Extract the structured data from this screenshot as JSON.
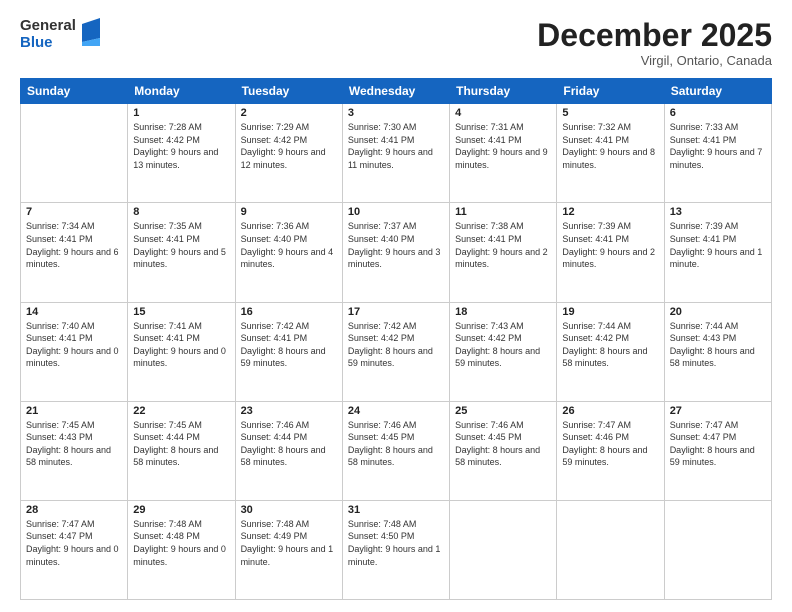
{
  "header": {
    "logo_general": "General",
    "logo_blue": "Blue",
    "month_title": "December 2025",
    "location": "Virgil, Ontario, Canada"
  },
  "days_of_week": [
    "Sunday",
    "Monday",
    "Tuesday",
    "Wednesday",
    "Thursday",
    "Friday",
    "Saturday"
  ],
  "weeks": [
    [
      {
        "day": "",
        "sunrise": "",
        "sunset": "",
        "daylight": ""
      },
      {
        "day": "1",
        "sunrise": "Sunrise: 7:28 AM",
        "sunset": "Sunset: 4:42 PM",
        "daylight": "Daylight: 9 hours and 13 minutes."
      },
      {
        "day": "2",
        "sunrise": "Sunrise: 7:29 AM",
        "sunset": "Sunset: 4:42 PM",
        "daylight": "Daylight: 9 hours and 12 minutes."
      },
      {
        "day": "3",
        "sunrise": "Sunrise: 7:30 AM",
        "sunset": "Sunset: 4:41 PM",
        "daylight": "Daylight: 9 hours and 11 minutes."
      },
      {
        "day": "4",
        "sunrise": "Sunrise: 7:31 AM",
        "sunset": "Sunset: 4:41 PM",
        "daylight": "Daylight: 9 hours and 9 minutes."
      },
      {
        "day": "5",
        "sunrise": "Sunrise: 7:32 AM",
        "sunset": "Sunset: 4:41 PM",
        "daylight": "Daylight: 9 hours and 8 minutes."
      },
      {
        "day": "6",
        "sunrise": "Sunrise: 7:33 AM",
        "sunset": "Sunset: 4:41 PM",
        "daylight": "Daylight: 9 hours and 7 minutes."
      }
    ],
    [
      {
        "day": "7",
        "sunrise": "Sunrise: 7:34 AM",
        "sunset": "Sunset: 4:41 PM",
        "daylight": "Daylight: 9 hours and 6 minutes."
      },
      {
        "day": "8",
        "sunrise": "Sunrise: 7:35 AM",
        "sunset": "Sunset: 4:41 PM",
        "daylight": "Daylight: 9 hours and 5 minutes."
      },
      {
        "day": "9",
        "sunrise": "Sunrise: 7:36 AM",
        "sunset": "Sunset: 4:40 PM",
        "daylight": "Daylight: 9 hours and 4 minutes."
      },
      {
        "day": "10",
        "sunrise": "Sunrise: 7:37 AM",
        "sunset": "Sunset: 4:40 PM",
        "daylight": "Daylight: 9 hours and 3 minutes."
      },
      {
        "day": "11",
        "sunrise": "Sunrise: 7:38 AM",
        "sunset": "Sunset: 4:41 PM",
        "daylight": "Daylight: 9 hours and 2 minutes."
      },
      {
        "day": "12",
        "sunrise": "Sunrise: 7:39 AM",
        "sunset": "Sunset: 4:41 PM",
        "daylight": "Daylight: 9 hours and 2 minutes."
      },
      {
        "day": "13",
        "sunrise": "Sunrise: 7:39 AM",
        "sunset": "Sunset: 4:41 PM",
        "daylight": "Daylight: 9 hours and 1 minute."
      }
    ],
    [
      {
        "day": "14",
        "sunrise": "Sunrise: 7:40 AM",
        "sunset": "Sunset: 4:41 PM",
        "daylight": "Daylight: 9 hours and 0 minutes."
      },
      {
        "day": "15",
        "sunrise": "Sunrise: 7:41 AM",
        "sunset": "Sunset: 4:41 PM",
        "daylight": "Daylight: 9 hours and 0 minutes."
      },
      {
        "day": "16",
        "sunrise": "Sunrise: 7:42 AM",
        "sunset": "Sunset: 4:41 PM",
        "daylight": "Daylight: 8 hours and 59 minutes."
      },
      {
        "day": "17",
        "sunrise": "Sunrise: 7:42 AM",
        "sunset": "Sunset: 4:42 PM",
        "daylight": "Daylight: 8 hours and 59 minutes."
      },
      {
        "day": "18",
        "sunrise": "Sunrise: 7:43 AM",
        "sunset": "Sunset: 4:42 PM",
        "daylight": "Daylight: 8 hours and 59 minutes."
      },
      {
        "day": "19",
        "sunrise": "Sunrise: 7:44 AM",
        "sunset": "Sunset: 4:42 PM",
        "daylight": "Daylight: 8 hours and 58 minutes."
      },
      {
        "day": "20",
        "sunrise": "Sunrise: 7:44 AM",
        "sunset": "Sunset: 4:43 PM",
        "daylight": "Daylight: 8 hours and 58 minutes."
      }
    ],
    [
      {
        "day": "21",
        "sunrise": "Sunrise: 7:45 AM",
        "sunset": "Sunset: 4:43 PM",
        "daylight": "Daylight: 8 hours and 58 minutes."
      },
      {
        "day": "22",
        "sunrise": "Sunrise: 7:45 AM",
        "sunset": "Sunset: 4:44 PM",
        "daylight": "Daylight: 8 hours and 58 minutes."
      },
      {
        "day": "23",
        "sunrise": "Sunrise: 7:46 AM",
        "sunset": "Sunset: 4:44 PM",
        "daylight": "Daylight: 8 hours and 58 minutes."
      },
      {
        "day": "24",
        "sunrise": "Sunrise: 7:46 AM",
        "sunset": "Sunset: 4:45 PM",
        "daylight": "Daylight: 8 hours and 58 minutes."
      },
      {
        "day": "25",
        "sunrise": "Sunrise: 7:46 AM",
        "sunset": "Sunset: 4:45 PM",
        "daylight": "Daylight: 8 hours and 58 minutes."
      },
      {
        "day": "26",
        "sunrise": "Sunrise: 7:47 AM",
        "sunset": "Sunset: 4:46 PM",
        "daylight": "Daylight: 8 hours and 59 minutes."
      },
      {
        "day": "27",
        "sunrise": "Sunrise: 7:47 AM",
        "sunset": "Sunset: 4:47 PM",
        "daylight": "Daylight: 8 hours and 59 minutes."
      }
    ],
    [
      {
        "day": "28",
        "sunrise": "Sunrise: 7:47 AM",
        "sunset": "Sunset: 4:47 PM",
        "daylight": "Daylight: 9 hours and 0 minutes."
      },
      {
        "day": "29",
        "sunrise": "Sunrise: 7:48 AM",
        "sunset": "Sunset: 4:48 PM",
        "daylight": "Daylight: 9 hours and 0 minutes."
      },
      {
        "day": "30",
        "sunrise": "Sunrise: 7:48 AM",
        "sunset": "Sunset: 4:49 PM",
        "daylight": "Daylight: 9 hours and 1 minute."
      },
      {
        "day": "31",
        "sunrise": "Sunrise: 7:48 AM",
        "sunset": "Sunset: 4:50 PM",
        "daylight": "Daylight: 9 hours and 1 minute."
      },
      {
        "day": "",
        "sunrise": "",
        "sunset": "",
        "daylight": ""
      },
      {
        "day": "",
        "sunrise": "",
        "sunset": "",
        "daylight": ""
      },
      {
        "day": "",
        "sunrise": "",
        "sunset": "",
        "daylight": ""
      }
    ]
  ]
}
